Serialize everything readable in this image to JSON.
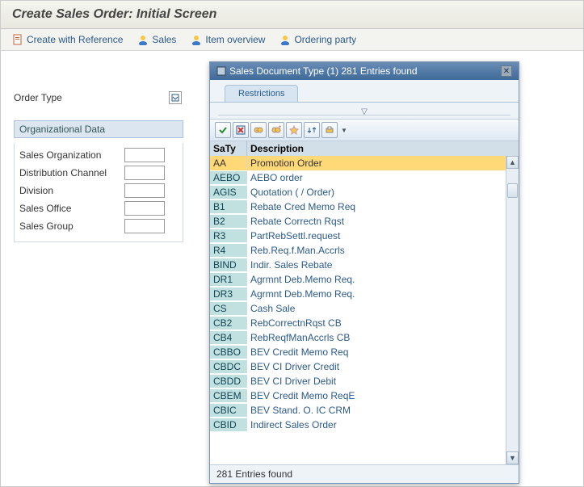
{
  "page_title": "Create Sales Order: Initial Screen",
  "toolbar": {
    "create_ref": "Create with Reference",
    "sales": "Sales",
    "item_overview": "Item overview",
    "ordering_party": "Ordering party"
  },
  "form": {
    "order_type_label": "Order Type"
  },
  "org_group": {
    "header": "Organizational Data",
    "sales_org": "Sales Organization",
    "dist_channel": "Distribution Channel",
    "division": "Division",
    "sales_office": "Sales Office",
    "sales_group": "Sales Group"
  },
  "popup": {
    "title": "Sales Document Type (1)  281 Entries found",
    "tab": "Restrictions",
    "col_saty": "SaTy",
    "col_desc": "Description",
    "status": "281 Entries found",
    "rows": [
      {
        "saty": "AA",
        "desc": "Promotion Order",
        "sel": true
      },
      {
        "saty": "AEBO",
        "desc": "AEBO order"
      },
      {
        "saty": "AGIS",
        "desc": "Quotation ( / Order)"
      },
      {
        "saty": "B1",
        "desc": "Rebate Cred Memo Req"
      },
      {
        "saty": "B2",
        "desc": "Rebate Correctn Rqst"
      },
      {
        "saty": "R3",
        "desc": "PartRebSettl.request"
      },
      {
        "saty": "R4",
        "desc": "Reb.Req.f.Man.Accrls"
      },
      {
        "saty": "BIND",
        "desc": "Indir. Sales Rebate"
      },
      {
        "saty": "DR1",
        "desc": "Agrmnt Deb.Memo Req."
      },
      {
        "saty": "DR3",
        "desc": "Agrmnt Deb.Memo Req."
      },
      {
        "saty": "CS",
        "desc": "Cash Sale"
      },
      {
        "saty": "CB2",
        "desc": "RebCorrectnRqst   CB"
      },
      {
        "saty": "CB4",
        "desc": "RebReqfManAccrls CB"
      },
      {
        "saty": "CBBO",
        "desc": "BEV Credit Memo Req"
      },
      {
        "saty": "CBDC",
        "desc": "BEV CI Driver Credit"
      },
      {
        "saty": "CBDD",
        "desc": "BEV CI Driver Debit"
      },
      {
        "saty": "CBEM",
        "desc": "BEV Credit Memo ReqE"
      },
      {
        "saty": "CBIC",
        "desc": "BEV Stand. O. IC CRM"
      },
      {
        "saty": "CBID",
        "desc": "Indirect Sales Order"
      }
    ]
  }
}
